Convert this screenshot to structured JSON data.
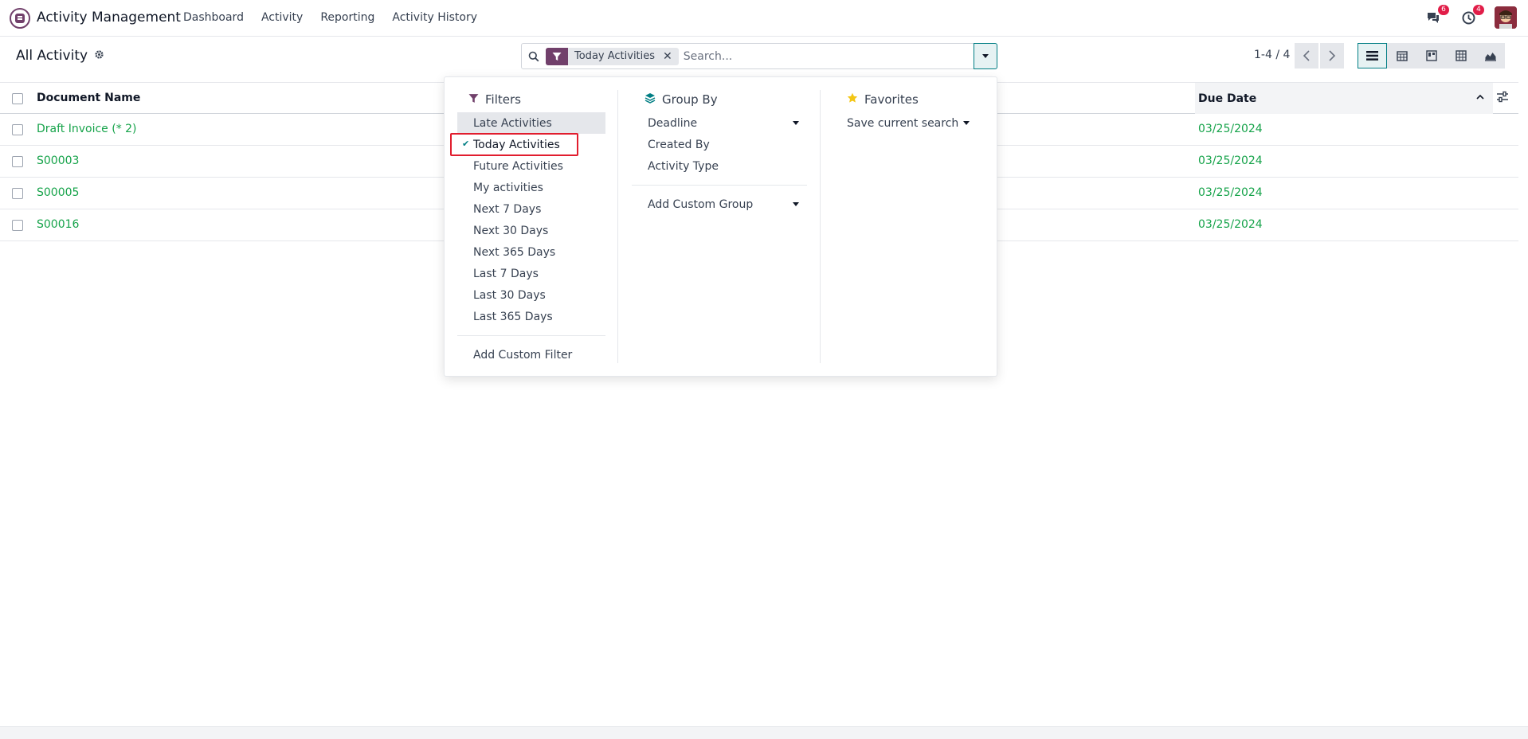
{
  "app": {
    "name": "Activity Management",
    "menu": [
      "Dashboard",
      "Activity",
      "Reporting",
      "Activity History"
    ],
    "messages_count": "6",
    "activities_count": "4"
  },
  "control": {
    "breadcrumb": "All Activity",
    "facet_value": "Today Activities",
    "search_placeholder": "Search...",
    "pager": "1-4 / 4"
  },
  "list": {
    "columns": {
      "document_name": "Document Name",
      "due_date": "Due Date"
    },
    "rows": [
      {
        "name": "Draft Invoice (* 2)",
        "due": "03/25/2024"
      },
      {
        "name": "S00003",
        "due": "03/25/2024"
      },
      {
        "name": "S00005",
        "due": "03/25/2024"
      },
      {
        "name": "S00016",
        "due": "03/25/2024"
      }
    ]
  },
  "dropdown": {
    "filters_title": "Filters",
    "filters": [
      "Late Activities",
      "Today Activities",
      "Future Activities",
      "My activities",
      "Next 7 Days",
      "Next 30 Days",
      "Next 365 Days",
      "Last 7 Days",
      "Last 30 Days",
      "Last 365 Days"
    ],
    "add_custom_filter": "Add Custom Filter",
    "groupby_title": "Group By",
    "groupby": [
      "Deadline",
      "Created By",
      "Activity Type"
    ],
    "add_custom_group": "Add Custom Group",
    "favorites_title": "Favorites",
    "save_current_search": "Save current search"
  },
  "colors": {
    "brand": "#71406b",
    "accent": "#017e84",
    "link_green": "#16a34a",
    "highlight_red": "#e11d2e"
  }
}
